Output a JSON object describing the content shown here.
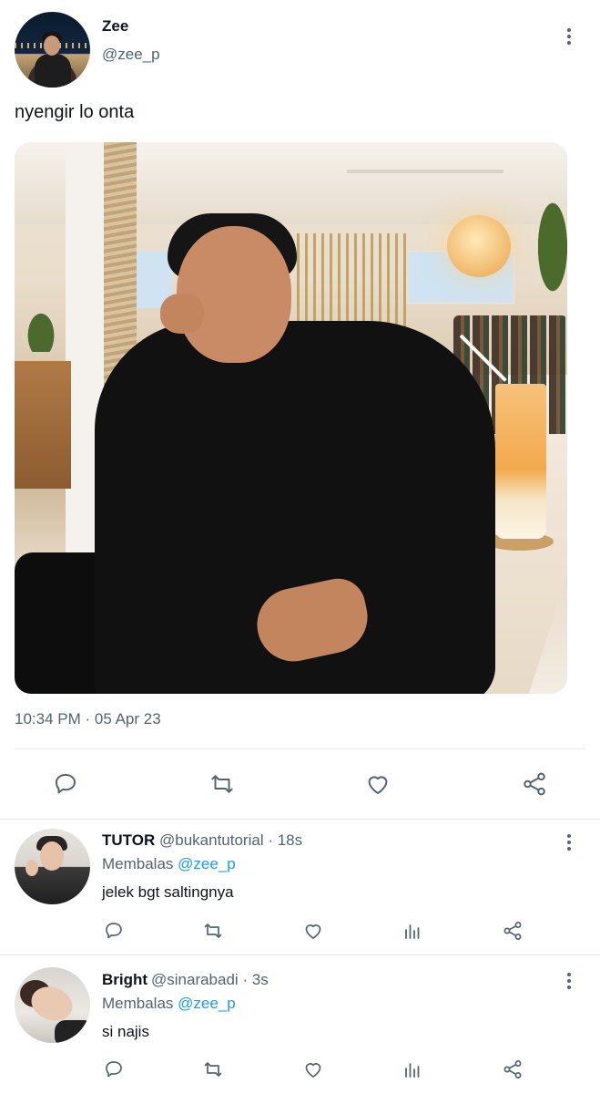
{
  "main_tweet": {
    "author_name": "Zee",
    "author_handle": "@zee_p",
    "text": "nyengir lo onta",
    "timestamp": "10:34 PM · 05 Apr 23",
    "actions": [
      "reply-icon",
      "retweet-icon",
      "like-icon",
      "share-icon"
    ]
  },
  "replies": [
    {
      "name": "TUTOR",
      "handle": "@bukantutorial",
      "time": "· 18s",
      "replying_prefix": "Membalas",
      "replying_to": "@zee_p",
      "text": "jelek bgt saltingnya",
      "actions": [
        "reply-icon",
        "retweet-icon",
        "like-icon",
        "analytics-icon",
        "share-icon"
      ]
    },
    {
      "name": "Bright",
      "handle": "@sinarabadi",
      "time": "· 3s",
      "replying_prefix": "Membalas",
      "replying_to": "@zee_p",
      "text": "si najis",
      "actions": [
        "reply-icon",
        "retweet-icon",
        "like-icon",
        "analytics-icon",
        "share-icon"
      ]
    }
  ],
  "colors": {
    "text_primary": "#0f1419",
    "text_secondary": "#536471",
    "link": "#1d9bf0",
    "divider": "#e6e9ec"
  }
}
